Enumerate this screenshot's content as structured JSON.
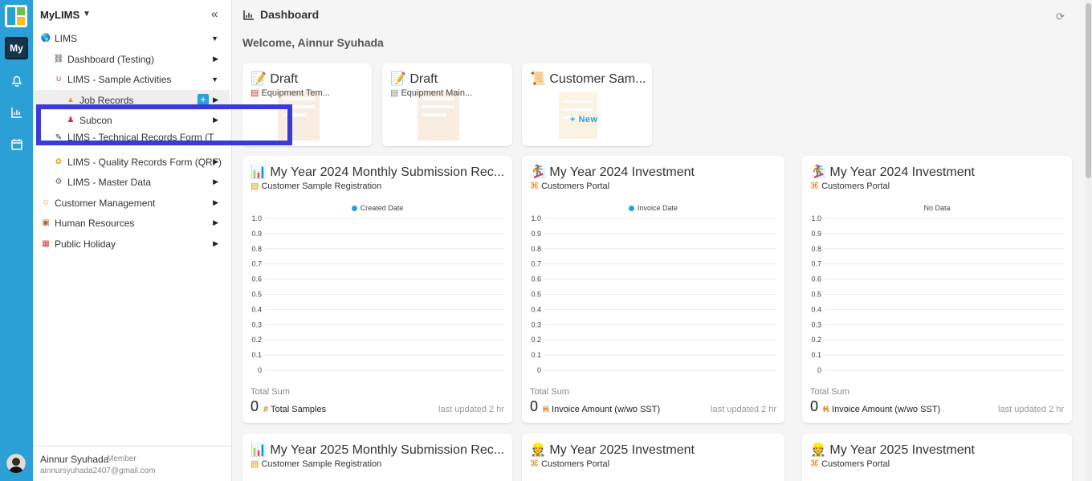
{
  "rail": {
    "badge": "My",
    "icons": [
      "app-logo-icon",
      "bell-icon",
      "bar-chart-icon",
      "calendar-icon"
    ]
  },
  "sidebar": {
    "app_title": "MyLIMS",
    "items": [
      {
        "label": "LIMS",
        "icon": "globe-icon"
      },
      {
        "label": "Dashboard (Testing)",
        "icon": "stamp-icon"
      },
      {
        "label": "LIMS - Sample Activities",
        "icon": "magnet-icon"
      },
      {
        "label": "Job Records",
        "icon": "warning-icon"
      },
      {
        "label": "Subcon",
        "icon": "stamp-red-icon"
      },
      {
        "label": "LIMS - Technical Records Form (T",
        "icon": "magic-icon"
      },
      {
        "label": "LIMS - Quality Records Form (QRF)",
        "icon": "sunflower-icon"
      },
      {
        "label": "LIMS - Master Data",
        "icon": "gear-icon"
      },
      {
        "label": "Customer Management",
        "icon": "smile-icon"
      },
      {
        "label": "Human Resources",
        "icon": "picture-icon"
      },
      {
        "label": "Public Holiday",
        "icon": "calendar-icon"
      }
    ],
    "user": {
      "name": "Ainnur Syuhada",
      "role": "Member",
      "email": "ainnursyuhada2407@gmail.com"
    }
  },
  "main": {
    "title": "Dashboard",
    "welcome": "Welcome, Ainnur Syuhada",
    "small_cards": [
      {
        "title": "Draft",
        "sub": "Equipment Tem...",
        "icon": "memo-icon"
      },
      {
        "title": "Draft",
        "sub": "Equipment Main...",
        "icon": "memo-icon"
      },
      {
        "title": "Customer Sam...",
        "sub": "",
        "new_label": "+ New",
        "icon": "scroll-icon"
      }
    ],
    "chart_cards": [
      {
        "title": "My Year 2024 Monthly Submission Rec...",
        "sub": "Customer Sample Registration",
        "legend": "Created Date",
        "has_dot": true,
        "total_label": "Total Sum",
        "total": "0",
        "total_name": "Total Samples",
        "total_icon": "#",
        "updated": "last updated 2 hr"
      },
      {
        "title": "My Year 2024 Investment",
        "sub": "Customers Portal",
        "legend": "Invoice Date",
        "has_dot": true,
        "total_label": "Total Sum",
        "total": "0",
        "total_name": "Invoice Amount (w/wo SST)",
        "total_icon": "₭",
        "updated": "last updated 2 hr"
      },
      {
        "title": "My Year 2024 Investment",
        "sub": "Customers Portal",
        "legend": "No Data",
        "has_dot": false,
        "total_label": "Total Sum",
        "total": "0",
        "total_name": "Invoice Amount (w/wo SST)",
        "total_icon": "₭",
        "updated": "last updated 2 hr"
      },
      {
        "title": "My Year 2025 Monthly Submission Rec...",
        "sub": "Customer Sample Registration"
      },
      {
        "title": "My Year 2025 Investment",
        "sub": "Customers Portal"
      },
      {
        "title": "My Year 2025 Investment",
        "sub": "Customers Portal"
      }
    ],
    "y_ticks": [
      "1.0",
      "0.9",
      "0.8",
      "0.7",
      "0.6",
      "0.5",
      "0.4",
      "0.3",
      "0.2",
      "0.1",
      "0"
    ]
  },
  "chart_data": [
    {
      "type": "bar",
      "title": "My Year 2024 Monthly Submission Rec...",
      "series": [
        {
          "name": "Created Date",
          "values": []
        }
      ],
      "ylim": [
        0,
        1.0
      ],
      "yticks": [
        1.0,
        0.9,
        0.8,
        0.7,
        0.6,
        0.5,
        0.4,
        0.3,
        0.2,
        0.1,
        0
      ],
      "grid": true,
      "legend": "top-center"
    },
    {
      "type": "bar",
      "title": "My Year 2024 Investment",
      "series": [
        {
          "name": "Invoice Date",
          "values": []
        }
      ],
      "ylim": [
        0,
        1.0
      ],
      "yticks": [
        1.0,
        0.9,
        0.8,
        0.7,
        0.6,
        0.5,
        0.4,
        0.3,
        0.2,
        0.1,
        0
      ],
      "grid": true,
      "legend": "top-center"
    },
    {
      "type": "bar",
      "title": "My Year 2024 Investment",
      "series": [],
      "annotation": "No Data",
      "ylim": [
        0,
        1.0
      ],
      "yticks": [
        1.0,
        0.9,
        0.8,
        0.7,
        0.6,
        0.5,
        0.4,
        0.3,
        0.2,
        0.1,
        0
      ],
      "grid": true
    }
  ],
  "colors": {
    "rail": "#2aa0d6",
    "accent": "#2aa0d6",
    "highlight": "#3a3ad8"
  }
}
